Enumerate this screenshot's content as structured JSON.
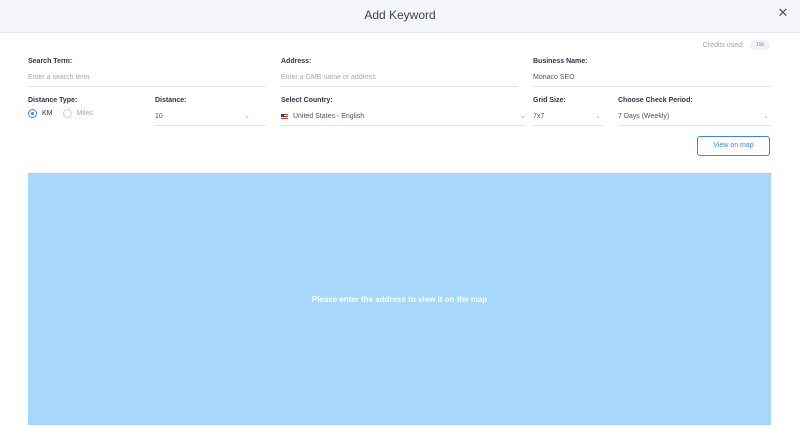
{
  "dialog": {
    "title": "Add Keyword"
  },
  "credits": {
    "label": "Credits used:",
    "value": "19k"
  },
  "fields": {
    "search_term": {
      "label": "Search Term:",
      "placeholder": "Enter a search term"
    },
    "address": {
      "label": "Address:",
      "placeholder": "Enter a GMB name or address"
    },
    "business_name": {
      "label": "Business Name:",
      "value": "Monaco SEO"
    },
    "distance_type": {
      "label": "Distance Type:",
      "options": [
        "KM",
        "Miles"
      ],
      "selected": "KM"
    },
    "distance": {
      "label": "Distance:",
      "value": "10"
    },
    "country": {
      "label": "Select Country:",
      "value": "United States - English"
    },
    "grid_size": {
      "label": "Grid Size:",
      "value": "7x7"
    },
    "check_period": {
      "label": "Choose Check Period:",
      "value": "7 Days (Weekly)"
    }
  },
  "actions": {
    "view_on_map": "View on map"
  },
  "map": {
    "message": "Please enter the address to view it on the map",
    "color": "#a8d7fd"
  },
  "colors": {
    "accent": "#3b82f6",
    "header_bg": "#f4f6f9"
  }
}
